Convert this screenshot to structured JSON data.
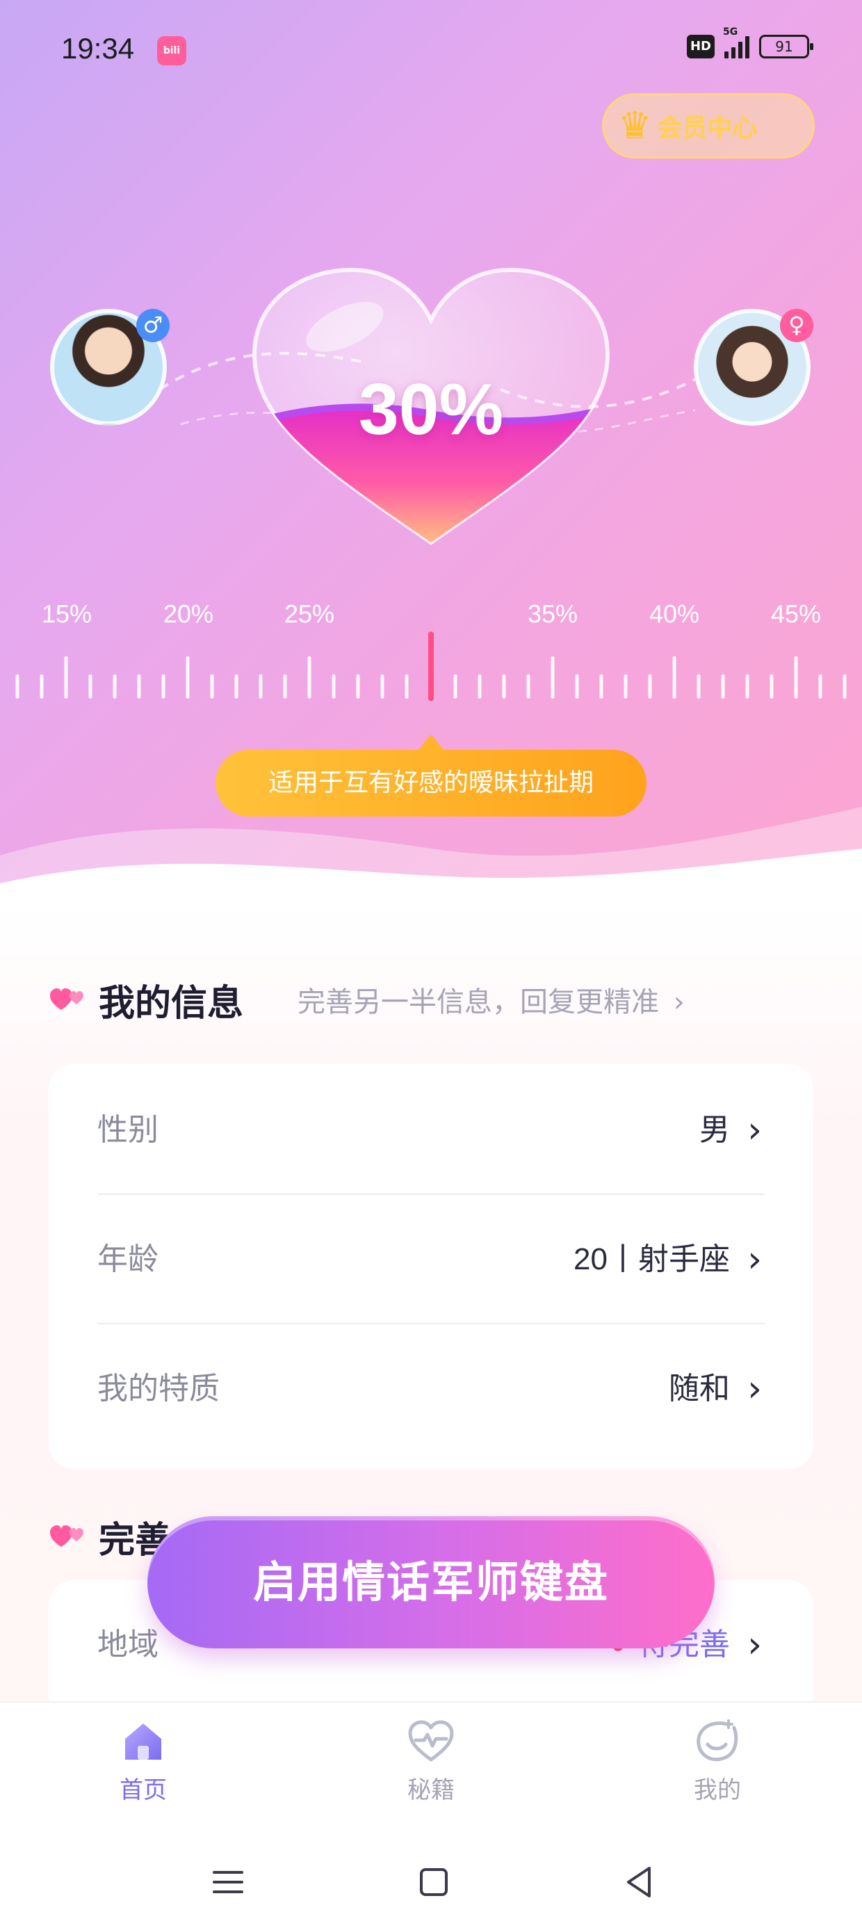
{
  "status_bar": {
    "time": "19:34",
    "app_icon_text": "bili",
    "hd": "HD",
    "network": "5G",
    "battery": "91"
  },
  "vip": {
    "label": "会员中心",
    "icon": "crown-icon"
  },
  "meter": {
    "percent_text": "30%",
    "value": 30,
    "tick_labels": [
      "15%",
      "20%",
      "25%",
      "35%",
      "40%",
      "45%"
    ],
    "description": "适用于互有好感的暧昧拉扯期"
  },
  "my_info": {
    "title": "我的信息",
    "hint": "完善另一半信息，回复更精准",
    "rows": [
      {
        "label": "性别",
        "value": "男"
      },
      {
        "label": "年龄",
        "value": "20丨射手座"
      },
      {
        "label": "我的特质",
        "value": "随和"
      }
    ]
  },
  "complete_section": {
    "title": "完善",
    "rows": [
      {
        "label": "地域",
        "value": "待完善"
      }
    ]
  },
  "cta": {
    "label": "启用情话军师键盘"
  },
  "tabs": [
    {
      "label": "首页",
      "icon": "home-icon",
      "active": true
    },
    {
      "label": "秘籍",
      "icon": "heart-pulse-icon",
      "active": false
    },
    {
      "label": "我的",
      "icon": "profile-icon",
      "active": false
    }
  ],
  "colors": {
    "accent": "#7b6cf0",
    "pink": "#ff6ec9",
    "tip": "#ffb42c"
  }
}
